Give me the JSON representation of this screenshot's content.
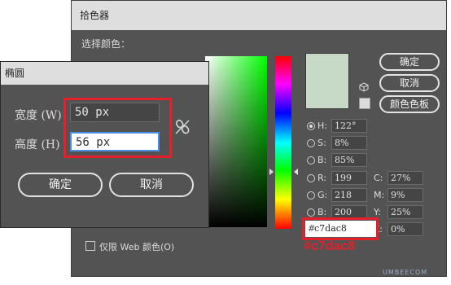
{
  "picker": {
    "title": "拾色器",
    "select_label": "选择颜色：",
    "buttons": {
      "ok": "确定",
      "cancel": "取消",
      "swatches": "颜色色板"
    },
    "current_color": "#c7dac8",
    "hsb": [
      {
        "label": "H:",
        "value": "122°",
        "checked": true
      },
      {
        "label": "S:",
        "value": "8%",
        "checked": false
      },
      {
        "label": "B:",
        "value": "85%",
        "checked": false
      }
    ],
    "rgb": [
      {
        "label": "R:",
        "value": "199"
      },
      {
        "label": "G:",
        "value": "218"
      },
      {
        "label": "B:",
        "value": "200"
      }
    ],
    "cmyk": [
      {
        "label": "C:",
        "value": "27%"
      },
      {
        "label": "M:",
        "value": "9%"
      },
      {
        "label": "Y:",
        "value": "25%"
      },
      {
        "label": "K:",
        "value": "0%"
      }
    ],
    "hex": {
      "hash": "#",
      "value": "c7dac8"
    },
    "hex_caption": "#c7dac8",
    "web_only_label": "仅限 Web 颜色(O)",
    "highlight_color": "#e6202b"
  },
  "ellipse": {
    "title": "椭圆",
    "width_label": "宽度 (W)",
    "width_value": "50 px",
    "height_label": "高度 (H)",
    "height_value": "56 px",
    "ok": "确定",
    "cancel": "取消"
  },
  "watermark": "UMBEECOM"
}
